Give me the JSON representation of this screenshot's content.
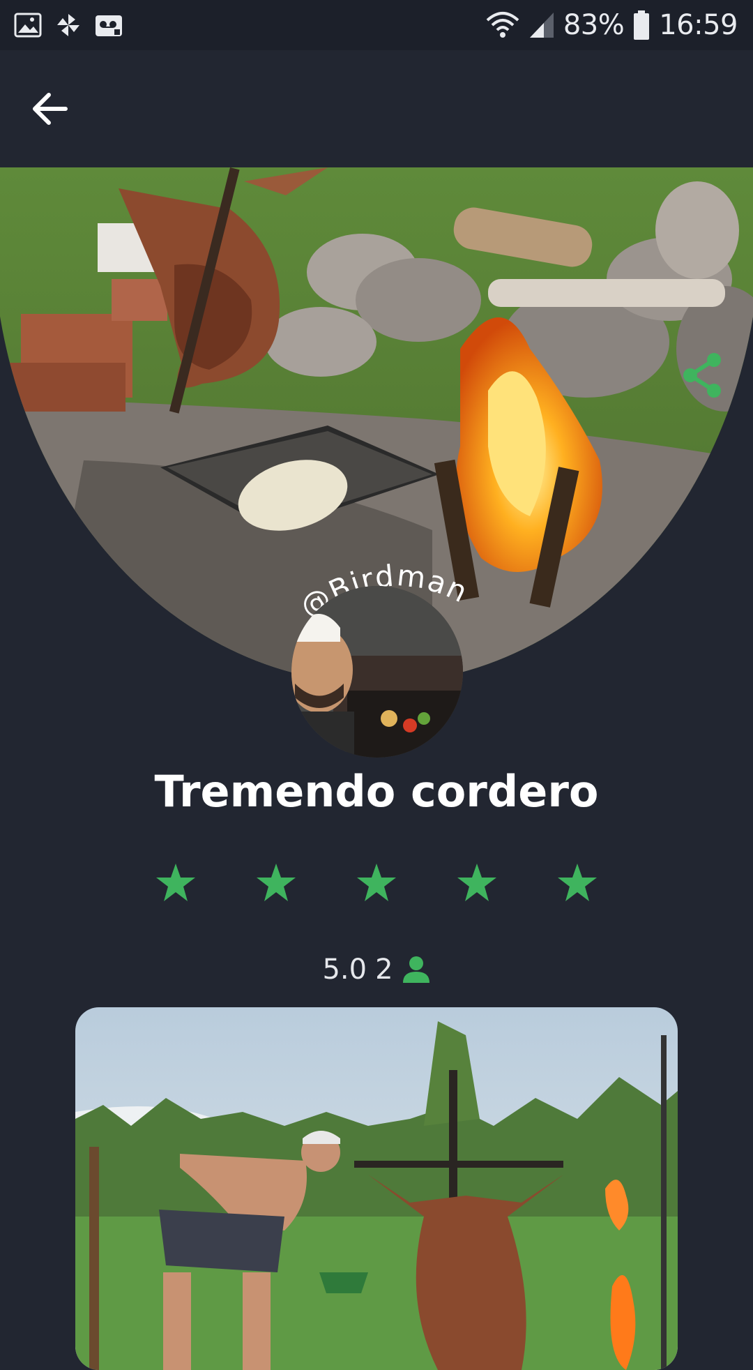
{
  "status_bar": {
    "battery": "83%",
    "time": "16:59",
    "icons": [
      "gallery-icon",
      "pinwheel-icon",
      "voicemail-icon",
      "wifi-icon",
      "signal-icon",
      "battery-icon"
    ]
  },
  "toolbar": {
    "back_icon": "arrow-left-icon"
  },
  "hero": {
    "share_icon": "share-icon"
  },
  "profile": {
    "username": "@Birdman"
  },
  "recipe": {
    "title": "Tremendo cordero",
    "rating_stars": 5,
    "rating_value": "5.0",
    "rating_count": "2"
  },
  "colors": {
    "background": "#222631",
    "status_bar": "#1c202a",
    "accent_green": "#3fb45e",
    "text": "#ffffff"
  }
}
